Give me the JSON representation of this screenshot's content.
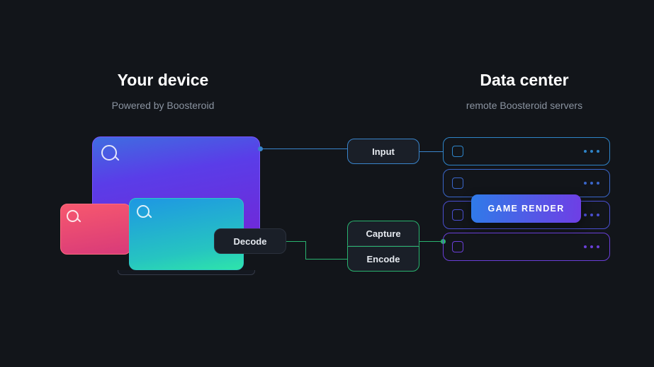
{
  "left": {
    "title": "Your device",
    "subtitle": "Powered by Boosteroid"
  },
  "right": {
    "title": "Data center",
    "subtitle": "remote Boosteroid servers"
  },
  "pills": {
    "decode": "Decode",
    "input": "Input",
    "capture": "Capture",
    "encode": "Encode"
  },
  "game_render": "GAME RENDER"
}
